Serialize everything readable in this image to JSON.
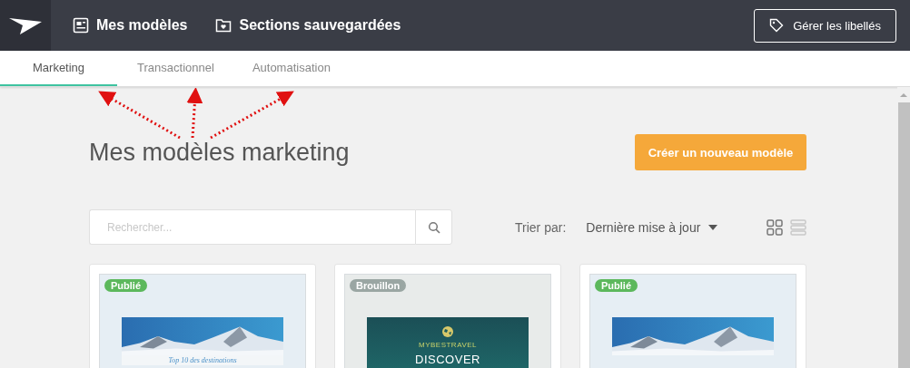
{
  "top_nav": {
    "items": [
      {
        "label": "Mes modèles"
      },
      {
        "label": "Sections sauvegardées"
      }
    ],
    "manage_button": "Gérer les libellés"
  },
  "tabs": [
    {
      "label": "Marketing",
      "selected": true
    },
    {
      "label": "Transactionnel",
      "selected": false
    },
    {
      "label": "Automatisation",
      "selected": false
    }
  ],
  "page_title": "Mes modèles marketing",
  "create_button": "Créer un nouveau modèle",
  "search": {
    "placeholder": "Rechercher..."
  },
  "sort": {
    "label": "Trier par:",
    "value": "Dernière mise à jour"
  },
  "view_modes": [
    {
      "kind": "grid",
      "selected": true
    },
    {
      "kind": "list",
      "selected": false
    }
  ],
  "templates": [
    {
      "status": "Publié",
      "published": true,
      "kind": "mountain",
      "subtitle": "Top 10 des destinations"
    },
    {
      "status": "Brouillon",
      "published": false,
      "kind": "travel",
      "brand": "MYBESTRAVEL",
      "headline": "DISCOVER"
    },
    {
      "status": "Publié",
      "published": true,
      "kind": "mountain"
    }
  ]
}
